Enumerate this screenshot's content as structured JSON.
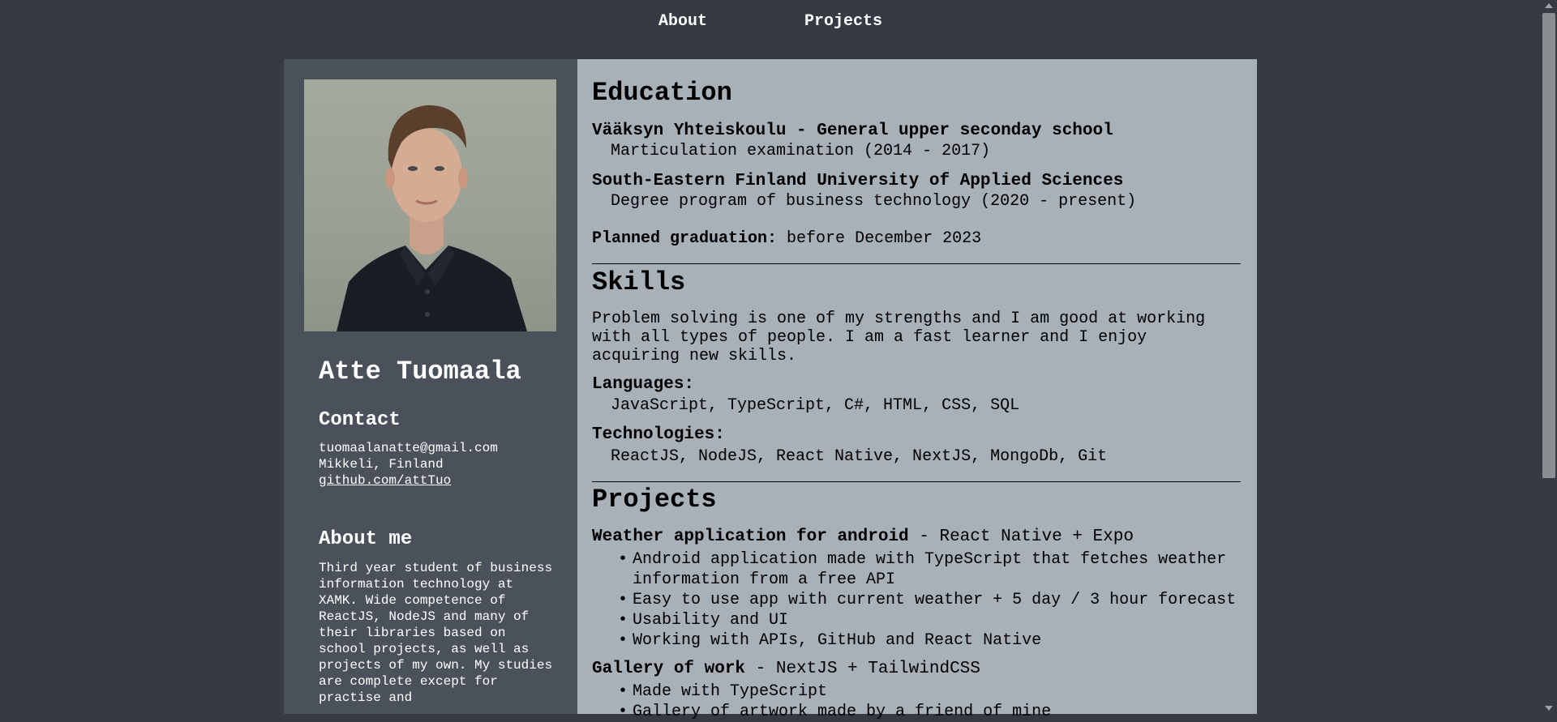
{
  "nav": {
    "about": "About",
    "projects": "Projects"
  },
  "profile": {
    "name": "Atte Tuomaala",
    "contact_heading": "Contact",
    "email": "tuomaalanatte@gmail.com",
    "location": "Mikkeli, Finland",
    "github": "github.com/attTuo",
    "about_heading": "About me",
    "about_text": "Third year student of business information technology at XAMK. Wide competence of ReactJS, NodeJS and many of their libraries based on school projects, as well as projects of my own. My studies are complete except for practise and"
  },
  "education": {
    "heading": "Education",
    "entries": [
      {
        "school": "Vääksyn Yhteiskoulu - General upper seconday school",
        "detail": "Marticulation examination (2014 - 2017)"
      },
      {
        "school": "South-Eastern Finland University of Applied Sciences",
        "detail": "Degree program of business technology (2020 - present)"
      }
    ],
    "graduation_label": "Planned graduation:",
    "graduation_value": " before December 2023"
  },
  "skills": {
    "heading": "Skills",
    "summary": "Problem solving is one of my strengths and I am good at working with all types of people. I am a fast learner and I enjoy acquiring new skills.",
    "languages_label": "Languages:",
    "languages": "JavaScript, TypeScript, C#, HTML, CSS, SQL",
    "technologies_label": "Technologies:",
    "technologies": "ReactJS, NodeJS, React Native, NextJS, MongoDb, Git"
  },
  "projects": {
    "heading": "Projects",
    "items": [
      {
        "title": "Weather application for android",
        "stack": " - React Native + Expo",
        "bullets": [
          "Android application made with TypeScript that fetches weather information from a free API",
          "Easy to use app with current weather + 5 day / 3 hour forecast",
          "Usability and UI",
          "Working with APIs, GitHub and React Native"
        ]
      },
      {
        "title": "Gallery of work",
        "stack": " - NextJS + TailwindCSS",
        "bullets": [
          "Made with TypeScript",
          "Gallery of artwork made by a friend of mine"
        ]
      }
    ]
  }
}
